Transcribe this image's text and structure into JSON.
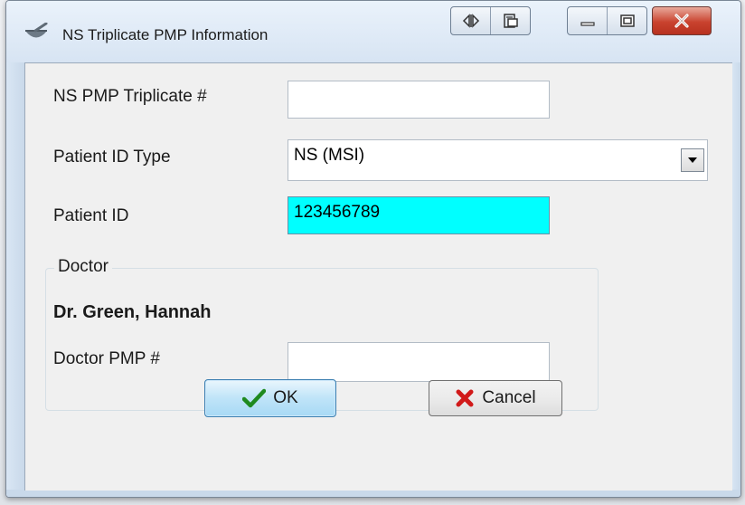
{
  "window": {
    "title": "NS Triplicate PMP Information",
    "colors": {
      "title_bar": "#d7e4f3",
      "close_button": "#c9422e",
      "highlight_field": "#00ffff"
    }
  },
  "title_buttons": {
    "icons": [
      "dock-arrows-icon",
      "copy-window-icon",
      "minimize-icon",
      "maximize-icon",
      "close-icon"
    ]
  },
  "form": {
    "triplicate_label": "NS PMP Triplicate #",
    "triplicate_value": "",
    "patient_id_type_label": "Patient ID Type",
    "patient_id_type_value": "NS (MSI)",
    "patient_id_label": "Patient ID",
    "patient_id_value": "123456789"
  },
  "doctor_group": {
    "legend": "Doctor",
    "doctor_name": "Dr. Green, Hannah",
    "doctor_pmp_label": "Doctor PMP #",
    "doctor_pmp_value": ""
  },
  "buttons": {
    "ok_label": "OK",
    "cancel_label": "Cancel"
  }
}
